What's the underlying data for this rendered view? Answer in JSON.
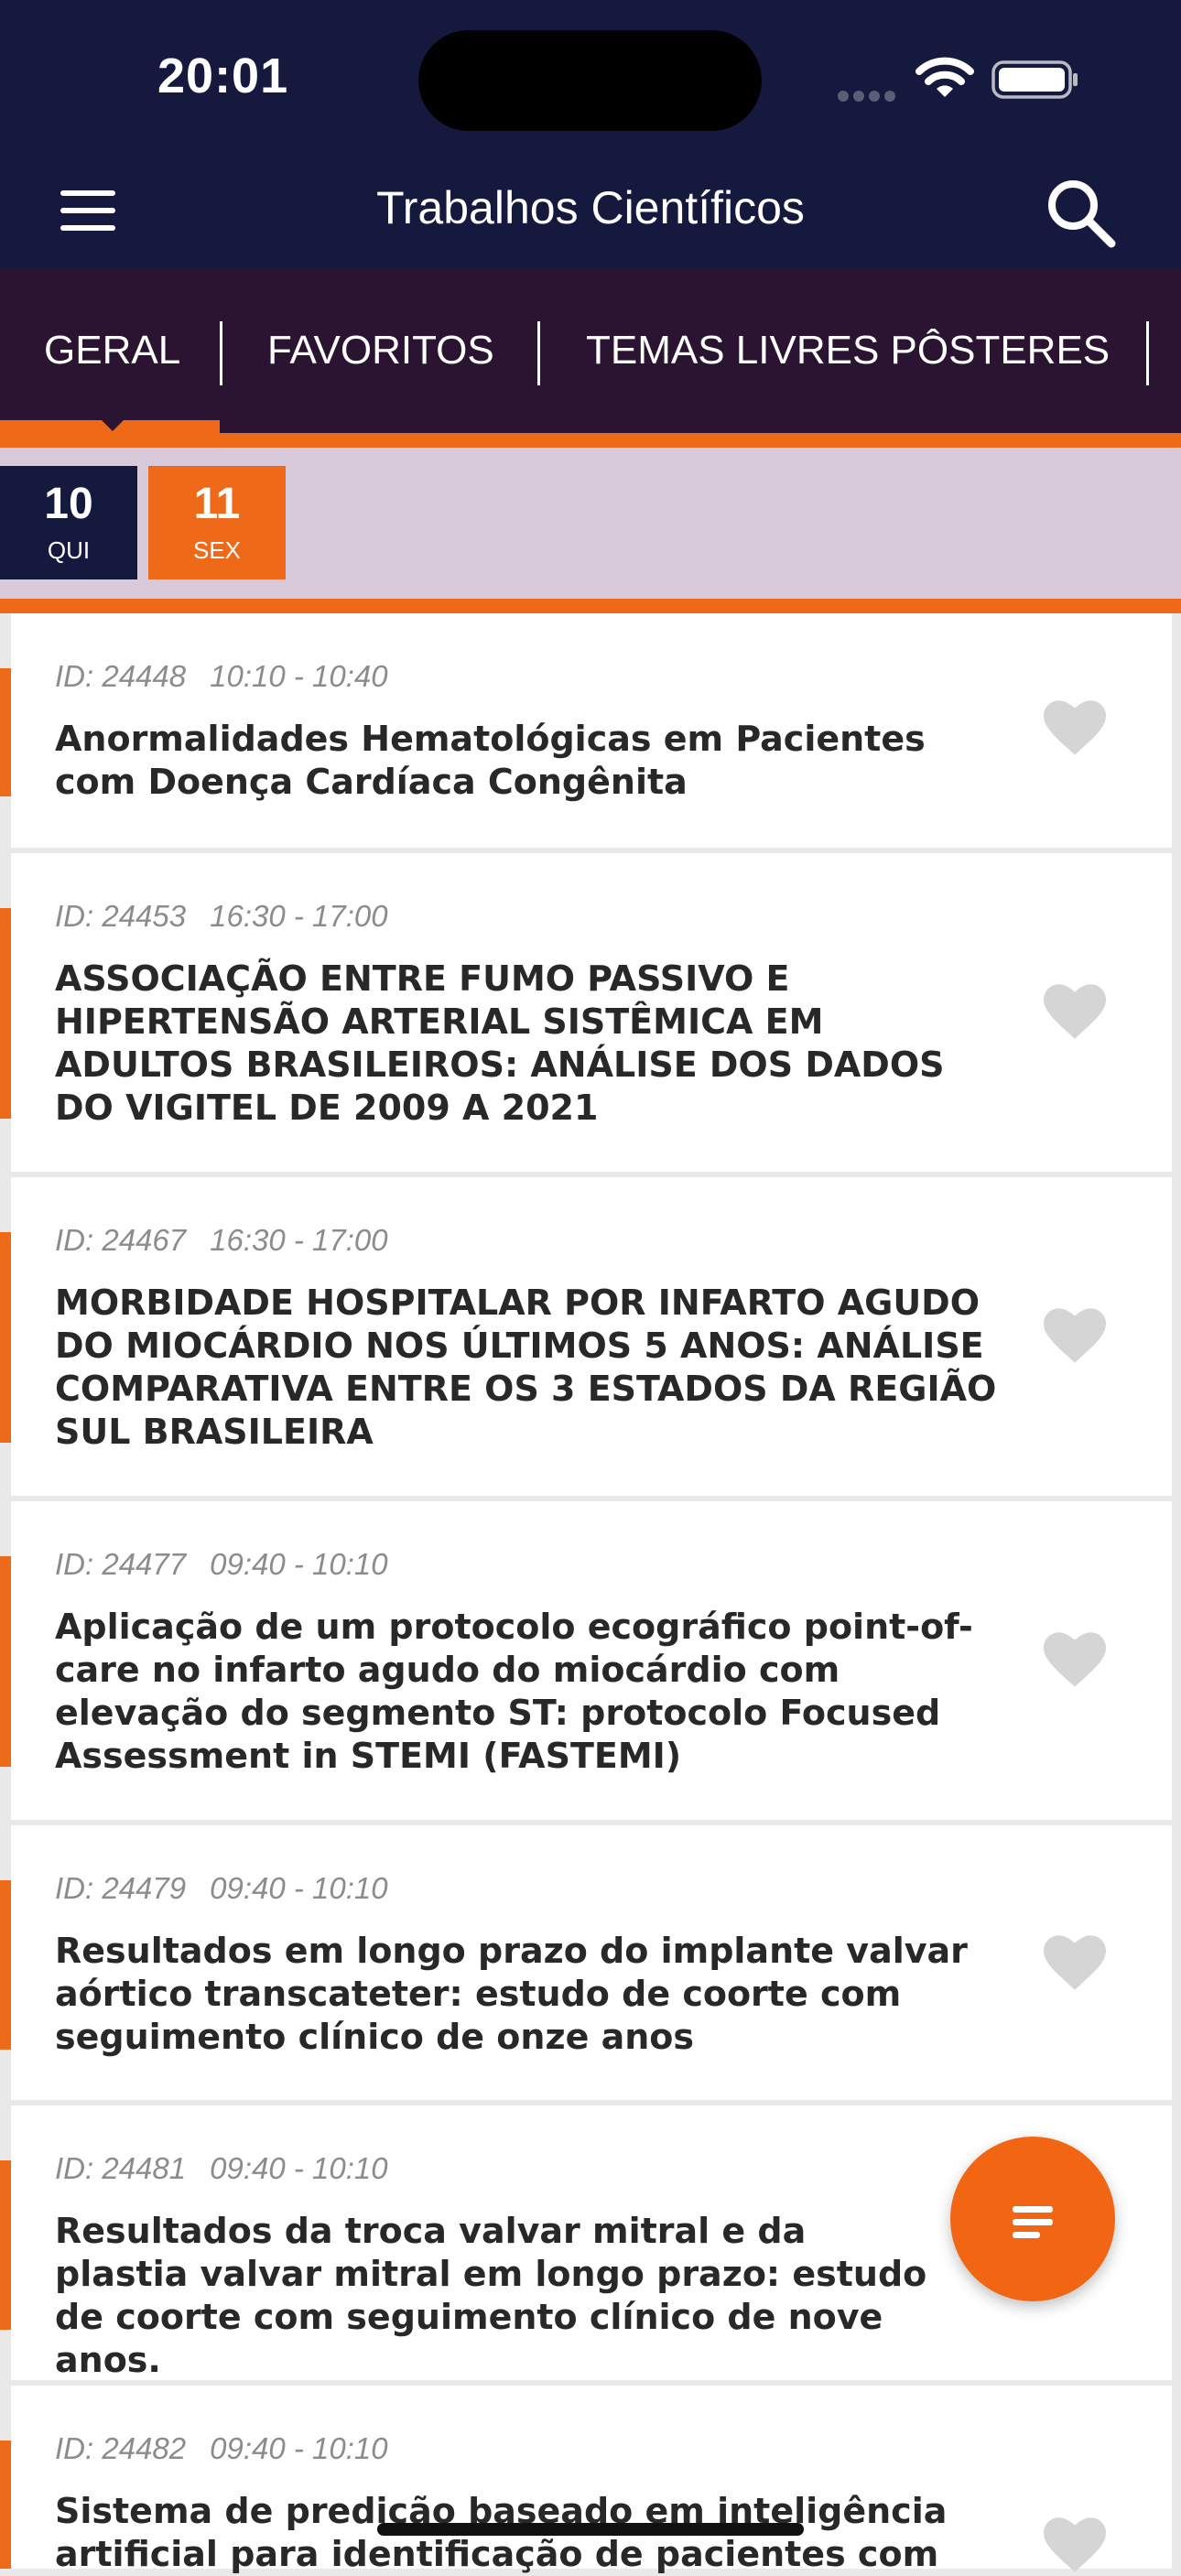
{
  "status_bar": {
    "time": "20:01"
  },
  "app_bar": {
    "title": "Trabalhos Científicos"
  },
  "tabs": [
    {
      "label": "GERAL"
    },
    {
      "label": "FAVORITOS"
    },
    {
      "label": "TEMAS LIVRES PÔSTERES"
    }
  ],
  "dates": [
    {
      "day": "10",
      "weekday": "QUI"
    },
    {
      "day": "11",
      "weekday": "SEX"
    }
  ],
  "items": [
    {
      "id": "ID: 24448",
      "time": "10:10 - 10:40",
      "title": "Anormalidades Hematológicas em Pacientes com Doença Cardíaca Congênita"
    },
    {
      "id": "ID: 24453",
      "time": "16:30 - 17:00",
      "title": "ASSOCIAÇÃO ENTRE FUMO PASSIVO E HIPERTENSÃO ARTERIAL SISTÊMICA EM ADULTOS BRASILEIROS: ANÁLISE DOS DADOS DO VIGITEL DE 2009 A 2021"
    },
    {
      "id": "ID: 24467",
      "time": "16:30 - 17:00",
      "title": "MORBIDADE HOSPITALAR POR INFARTO AGUDO DO MIOCÁRDIO NOS ÚLTIMOS 5 ANOS: ANÁLISE COMPARATIVA ENTRE OS 3 ESTADOS DA REGIÃO SUL BRASILEIRA"
    },
    {
      "id": "ID: 24477",
      "time": "09:40 - 10:10",
      "title": "Aplicação de um protocolo ecográfico point-of-care no infarto agudo do miocárdio com elevação do segmento ST: protocolo Focused Assessment in STEMI (FASTEMI)"
    },
    {
      "id": "ID: 24479",
      "time": "09:40 - 10:10",
      "title": "Resultados em longo prazo do implante valvar aórtico transcateter: estudo de coorte com seguimento clínico de onze anos"
    },
    {
      "id": "ID: 24481",
      "time": "09:40 - 10:10",
      "title": "Resultados da troca valvar mitral e da plastia valvar mitral em longo prazo: estudo de coorte com seguimento clínico de nove anos."
    },
    {
      "id": "ID: 24482",
      "time": "09:40 - 10:10",
      "title": "Sistema de predição baseado em inteligência artificial para identificação de pacientes com"
    }
  ],
  "colors": {
    "navy": "#15193d",
    "tab_bg": "#2a1431",
    "accent": "#ee6a18",
    "date_strip": "#d9cadb"
  }
}
